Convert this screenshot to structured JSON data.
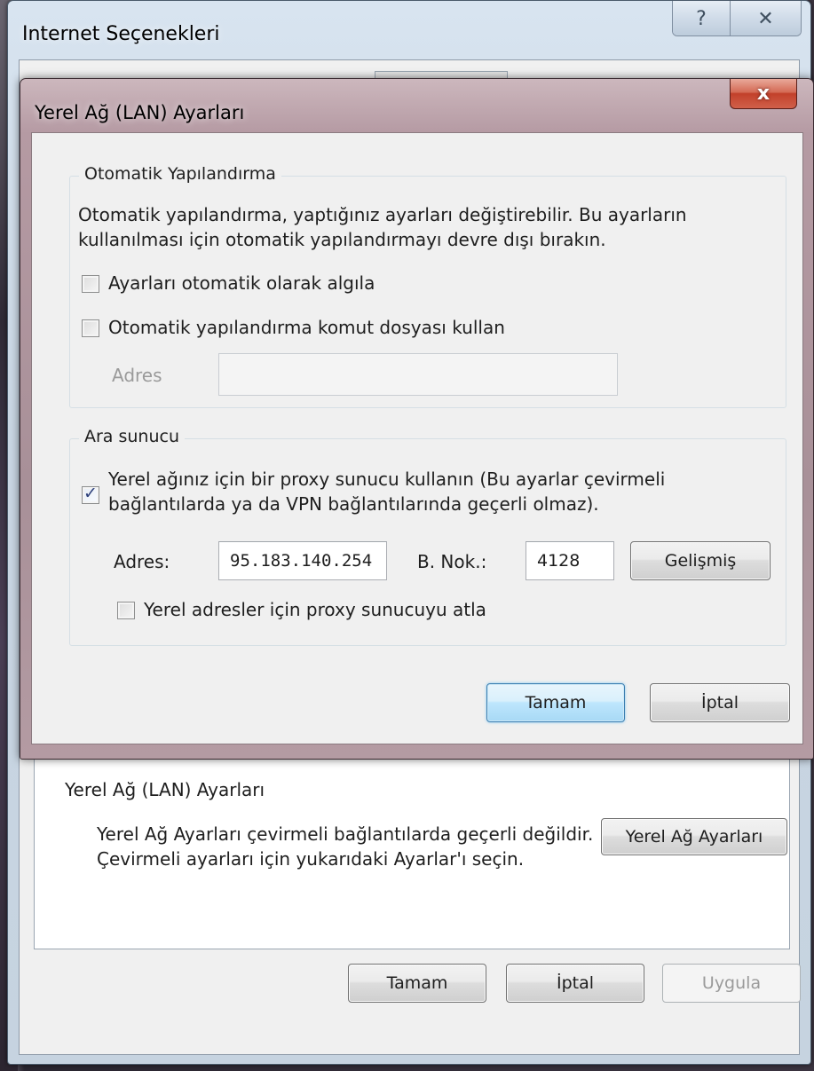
{
  "outer": {
    "title": "Internet Seçenekleri",
    "help_glyph": "?",
    "close_glyph": "✕",
    "lan_section_label": "Yerel Ağ (LAN) Ayarları",
    "lan_description": "Yerel Ağ Ayarları çevirmeli bağlantılarda geçerli değildir. Çevirmeli ayarları için yukarıdaki Ayarlar'ı seçin.",
    "lan_button": "Yerel Ağ Ayarları",
    "ok_button": "Tamam",
    "cancel_button": "İptal",
    "apply_button": "Uygula"
  },
  "lan_dialog": {
    "title": "Yerel Ağ (LAN) Ayarları",
    "close_glyph": "x",
    "auto_config": {
      "legend": "Otomatik Yapılandırma",
      "description": "Otomatik yapılandırma, yaptığınız ayarları değiştirebilir. Bu ayarların kullanılması için otomatik yapılandırmayı devre dışı bırakın.",
      "detect_label": "Ayarları otomatik olarak algıla",
      "detect_checked": false,
      "script_label": "Otomatik yapılandırma komut dosyası kullan",
      "script_checked": false,
      "address_label": "Adres",
      "address_value": ""
    },
    "proxy": {
      "legend": "Ara sunucu",
      "use_proxy_label": "Yerel ağınız için bir proxy sunucu kullanın (Bu ayarlar çevirmeli bağlantılarda ya da VPN bağlantılarında geçerli olmaz).",
      "use_proxy_checked": true,
      "check_glyph": "✓",
      "address_label": "Adres:",
      "address_value": "95.183.140.254",
      "port_label": "B. Nok.:",
      "port_value": "4128",
      "advanced_button": "Gelişmiş",
      "bypass_label": "Yerel adresler için proxy sunucuyu atla",
      "bypass_checked": false
    },
    "ok_button": "Tamam",
    "cancel_button": "İptal"
  }
}
